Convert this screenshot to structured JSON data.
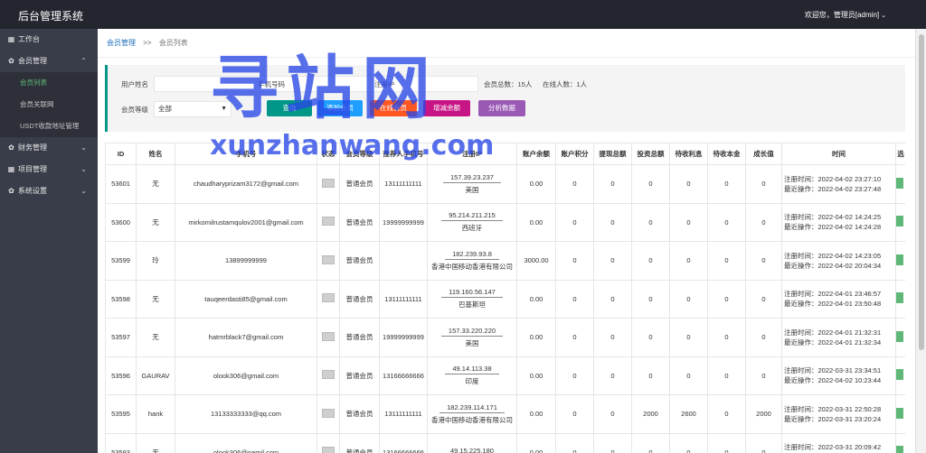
{
  "app": {
    "title": "后台管理系统",
    "user_text": "欢迎您，管理员[admin]"
  },
  "sidebar": {
    "items": [
      {
        "label": "工作台",
        "icon": "grid-icon"
      },
      {
        "label": "会员管理",
        "icon": "gear-icon",
        "expanded": true,
        "children": [
          "会员列表",
          "会员关联网",
          "USDT收款地址管理"
        ]
      },
      {
        "label": "财务管理",
        "icon": "gear-icon"
      },
      {
        "label": "项目管理",
        "icon": "grid-icon"
      },
      {
        "label": "系统设置",
        "icon": "gear-icon"
      }
    ]
  },
  "breadcrumb": {
    "parent": "会员管理",
    "sep": ">>",
    "current": "会员列表"
  },
  "filter": {
    "username_label": "用户姓名",
    "phone_label": "手机号码",
    "ip_label": "注册IP",
    "total_label": "会员总数：15人",
    "online_label": "在线人数：1人",
    "level_label": "会员等级",
    "level_value": "全部",
    "buttons": [
      "查询",
      "添加会员",
      "在线会员",
      "增减余额",
      "分析数据"
    ]
  },
  "watermark": {
    "big": "寻站网",
    "small": "xunzhanwang.com"
  },
  "table": {
    "headers": [
      "ID",
      "姓名",
      "手机号",
      "状态",
      "会员等级",
      "推荐人手机号",
      "注册IP",
      "账户余额",
      "账户积分",
      "提现总额",
      "投资总额",
      "待收利息",
      "待收本金",
      "成长值",
      "时间",
      "选"
    ],
    "reg_prefix": "注册时间：",
    "op_prefix": "最近操作：",
    "rows": [
      {
        "id": "53601",
        "name": "无",
        "phone": "chaudharyprizam3172@gmail.com",
        "level": "普通会员",
        "ref": "13111111111",
        "ip": "157.39.23.237",
        "loc": "美国",
        "bal": "0.00",
        "pts": "0",
        "wd": "0",
        "inv": "0",
        "int": "0",
        "prin": "0",
        "grow": "0",
        "reg": "2022-04-02 23:27:10",
        "op": "2022-04-02 23:27:48"
      },
      {
        "id": "53600",
        "name": "无",
        "phone": "mirkomilrustamqulov2001@gmail.com",
        "level": "普通会员",
        "ref": "19999999999",
        "ip": "95.214.211.215",
        "loc": "西班牙",
        "bal": "0.00",
        "pts": "0",
        "wd": "0",
        "inv": "0",
        "int": "0",
        "prin": "0",
        "grow": "0",
        "reg": "2022-04-02 14:24:25",
        "op": "2022-04-02 14:24:28"
      },
      {
        "id": "53599",
        "name": "玲",
        "phone": "13899999999",
        "level": "普通会员",
        "ref": "",
        "ip": "182.239.93.8",
        "loc": "香港中国移动香港有限公司",
        "bal": "3000.00",
        "pts": "0",
        "wd": "0",
        "inv": "0",
        "int": "0",
        "prin": "0",
        "grow": "0",
        "reg": "2022-04-02 14:23:05",
        "op": "2022-04-02 20:04:34"
      },
      {
        "id": "53598",
        "name": "无",
        "phone": "tauqeerdasti85@gmail.com",
        "level": "普通会员",
        "ref": "13111111111",
        "ip": "119.160.56.147",
        "loc": "巴基斯坦",
        "bal": "0.00",
        "pts": "0",
        "wd": "0",
        "inv": "0",
        "int": "0",
        "prin": "0",
        "grow": "0",
        "reg": "2022-04-01 23:46:57",
        "op": "2022-04-01 23:50:48"
      },
      {
        "id": "53597",
        "name": "无",
        "phone": "hatmrblack7@gmail.com",
        "level": "普通会员",
        "ref": "19999999999",
        "ip": "157.33.220.220",
        "loc": "美国",
        "bal": "0.00",
        "pts": "0",
        "wd": "0",
        "inv": "0",
        "int": "0",
        "prin": "0",
        "grow": "0",
        "reg": "2022-04-01 21:32:31",
        "op": "2022-04-01 21:32:34"
      },
      {
        "id": "53596",
        "name": "GAURAV",
        "phone": "olook306@gmail.com",
        "level": "普通会员",
        "ref": "13166666666",
        "ip": "49.14.113.38",
        "loc": "印度",
        "bal": "0.00",
        "pts": "0",
        "wd": "0",
        "inv": "0",
        "int": "0",
        "prin": "0",
        "grow": "0",
        "reg": "2022-03-31 23:34:51",
        "op": "2022-04-02 10:23:44"
      },
      {
        "id": "53595",
        "name": "hank",
        "phone": "13133333333@qq.com",
        "level": "普通会员",
        "ref": "13111111111",
        "ip": "182.239.114.171",
        "loc": "香港中国移动香港有限公司",
        "bal": "0.00",
        "pts": "0",
        "wd": "0",
        "inv": "2000",
        "int": "2600",
        "prin": "0",
        "grow": "2000",
        "reg": "2022-03-31 22:50:28",
        "op": "2022-03-31 23:20:24"
      },
      {
        "id": "53593",
        "name": "无",
        "phone": "olook306@gamil.com",
        "level": "普通会员",
        "ref": "13166666666",
        "ip": "49.15.225.180",
        "loc": "",
        "bal": "0.00",
        "pts": "0",
        "wd": "0",
        "inv": "0",
        "int": "0",
        "prin": "0",
        "grow": "0",
        "reg": "2022-03-31 20:09:42",
        "op": ""
      }
    ]
  }
}
